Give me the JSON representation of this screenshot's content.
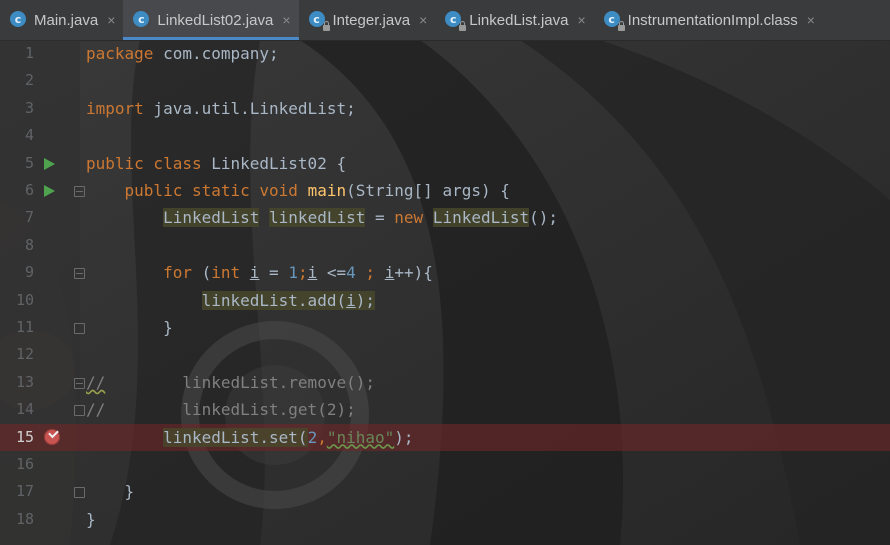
{
  "tabs": [
    {
      "label": "Main.java",
      "locked": false,
      "active": false
    },
    {
      "label": "LinkedList02.java",
      "locked": false,
      "active": true
    },
    {
      "label": "Integer.java",
      "locked": true,
      "active": false
    },
    {
      "label": "LinkedList.java",
      "locked": true,
      "active": false
    },
    {
      "label": "InstrumentationImpl.class",
      "locked": true,
      "active": false
    }
  ],
  "tab_close_glyph": "×",
  "class_icon_letter": "c",
  "line_numbers": [
    "1",
    "2",
    "3",
    "4",
    "5",
    "6",
    "7",
    "8",
    "9",
    "10",
    "11",
    "12",
    "13",
    "14",
    "15",
    "16",
    "17",
    "18"
  ],
  "code": {
    "l1": {
      "kw": "package",
      "rest": " com.company;"
    },
    "l3": {
      "kw": "import",
      "rest": " java.util.LinkedList;"
    },
    "l5": {
      "kw1": "public",
      "kw2": " class",
      "rest": " LinkedList02 {"
    },
    "l6": {
      "kw1": "public",
      "kw2": " static",
      "kw3": " void",
      "fn": "main",
      "rest": "(String[] args) {"
    },
    "l7": {
      "type": "LinkedList",
      "var": "linkedList",
      "eq": " = ",
      "kw": "new",
      "ctor": "LinkedList",
      "tail": "();"
    },
    "l9": {
      "kw1": "for",
      "p1": " (",
      "kw2": "int",
      "v1": "i",
      "p2": " = ",
      "n1": "1",
      "semi1": ";",
      "v2": "i",
      "p3": " <=",
      "n2": "4",
      "semi2": " ;",
      "v3": "i",
      "p4": "++){"
    },
    "l10": {
      "call": "linkedList.add(",
      "arg": "i",
      "end": ");"
    },
    "l11": {
      "text": "}"
    },
    "l13": {
      "cmt": "//",
      "rest": "        linkedList.remove();"
    },
    "l14": {
      "cmt": "//",
      "rest": "        linkedList.get(2);"
    },
    "l15": {
      "call": "linkedList.set(",
      "n": "2",
      "comma": ",",
      "str": "\"nihao\"",
      "end": ");"
    },
    "l17": {
      "text": "}"
    },
    "l18": {
      "text": "}"
    }
  },
  "colors": {
    "keyword": "#cc7832",
    "number": "#6897bb",
    "string": "#6a8759",
    "method": "#ffc66d",
    "breakpoint_line": "#6e2626",
    "active_tab_underline": "#4a88c7"
  }
}
